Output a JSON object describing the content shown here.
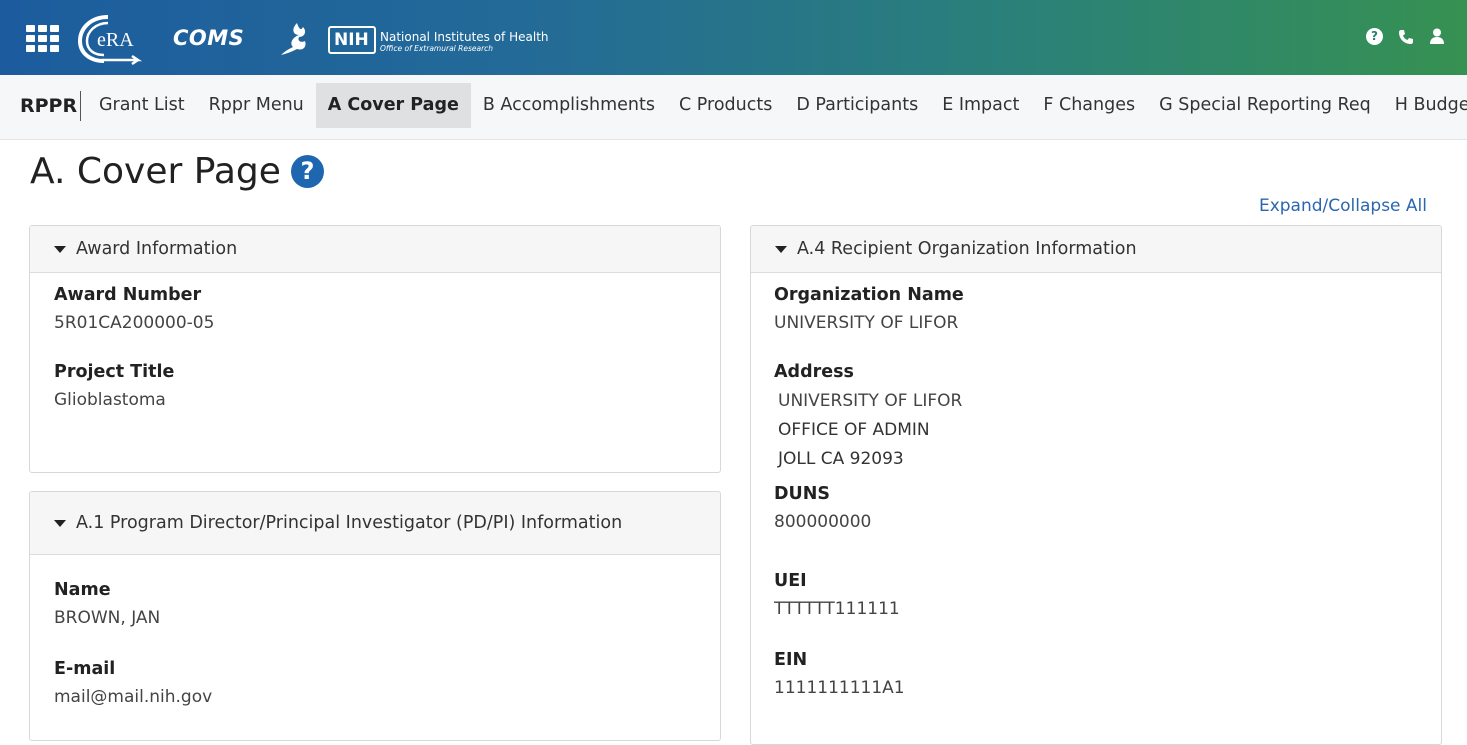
{
  "header": {
    "app_name": "COMS",
    "era_logo_text": "eRA",
    "nih_badge": "NIH",
    "nih_line1": "National Institutes of Health",
    "nih_line2": "Office of Extramural Research",
    "help_glyph": "?"
  },
  "nav": {
    "brand": "RPPR",
    "items": [
      {
        "label": "Grant List"
      },
      {
        "label": "Rppr Menu"
      },
      {
        "label": "A Cover Page",
        "active": true
      },
      {
        "label": "B Accomplishments"
      },
      {
        "label": "C Products"
      },
      {
        "label": "D Participants"
      },
      {
        "label": "E Impact"
      },
      {
        "label": "F Changes"
      },
      {
        "label": "G Special Reporting Req"
      },
      {
        "label": "H Budget"
      }
    ]
  },
  "page": {
    "title": "A. Cover Page",
    "help_glyph": "?",
    "expand_collapse": "Expand/Collapse All"
  },
  "award": {
    "heading": "Award Information",
    "award_number_label": "Award Number",
    "award_number": "5R01CA200000-05",
    "project_title_label": "Project Title",
    "project_title": "Glioblastoma"
  },
  "pdpi": {
    "heading": "A.1 Program Director/Principal Investigator (PD/PI) Information",
    "name_label": "Name",
    "name": "BROWN, JAN",
    "email_label": "E-mail",
    "email": "mail@mail.nih.gov"
  },
  "org": {
    "heading": "A.4 Recipient Organization Information",
    "org_name_label": "Organization Name",
    "org_name": "UNIVERSITY OF LIFOR",
    "address_label": "Address",
    "address_lines": [
      "UNIVERSITY OF LIFOR",
      "OFFICE OF ADMIN",
      "JOLL CA 92093"
    ],
    "duns_label": "DUNS",
    "duns": "800000000",
    "uei_label": "UEI",
    "uei": "TTTTTT111111",
    "ein_label": "EIN",
    "ein": "1111111111A1"
  },
  "icons": {
    "apps": "grid-icon",
    "help": "help-icon",
    "phone": "phone-icon",
    "user": "user-icon"
  }
}
